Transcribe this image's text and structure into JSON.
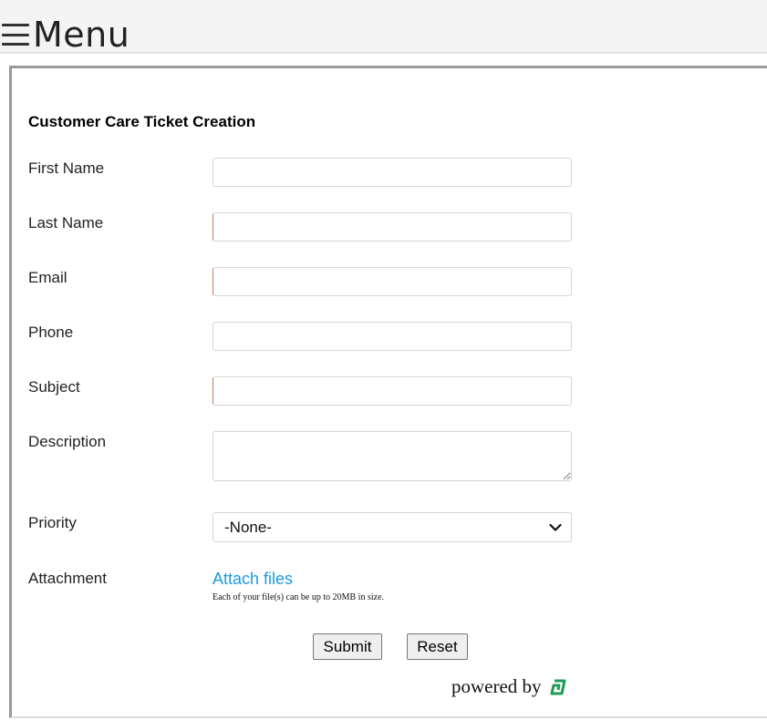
{
  "header": {
    "menu_label": "Menu"
  },
  "form": {
    "title": "Customer Care Ticket Creation",
    "fields": {
      "first_name": {
        "label": "First Name",
        "value": ""
      },
      "last_name": {
        "label": "Last Name",
        "value": ""
      },
      "email": {
        "label": "Email",
        "value": ""
      },
      "phone": {
        "label": "Phone",
        "value": ""
      },
      "subject": {
        "label": "Subject",
        "value": ""
      },
      "description": {
        "label": "Description",
        "value": ""
      },
      "priority": {
        "label": "Priority",
        "selected": "-None-"
      },
      "attachment": {
        "label": "Attachment",
        "link_text": "Attach files",
        "note": "Each of your file(s) can be up to 20MB in size."
      }
    },
    "buttons": {
      "submit": "Submit",
      "reset": "Reset"
    },
    "footer": {
      "powered_by": "powered by"
    }
  },
  "colors": {
    "link": "#1a9be0",
    "brand_logo": "#1f9d55",
    "required_marker": "#c0806a"
  },
  "icons": {
    "menu": "hamburger-icon",
    "dropdown": "chevron-down-icon",
    "brand": "zoho-desk-logo-icon"
  }
}
